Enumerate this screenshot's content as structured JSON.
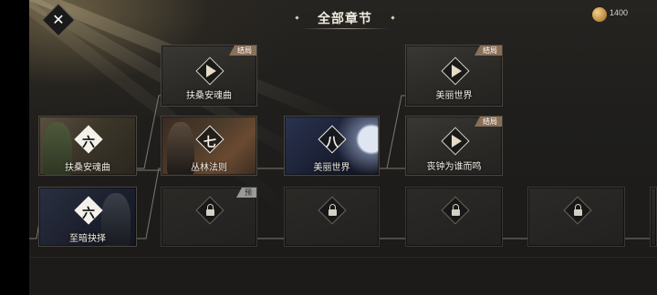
{
  "header": {
    "title": "全部章节",
    "coins": "1400"
  },
  "colors": {
    "ending_badge": "#8a6f57",
    "preview_badge": "#9a9a9a",
    "background": "#1f1e1c",
    "text": "#f3eee4"
  },
  "chapters": {
    "ch6_upper": {
      "number": "六",
      "name": "扶桑安魂曲"
    },
    "ch6_lower": {
      "number": "六",
      "name": "至暗抉择"
    },
    "ch7": {
      "number": "七",
      "name": "丛林法则"
    },
    "ch8": {
      "number": "八",
      "name": "美丽世界"
    }
  },
  "endings": {
    "ending_a": {
      "badge": "结局",
      "name": "扶桑安魂曲"
    },
    "ending_b": {
      "badge": "结局",
      "name": "美丽世界"
    },
    "ending_c": {
      "badge": "结局",
      "name": "丧钟为谁而鸣"
    }
  },
  "locked": {
    "preview_badge": "预"
  },
  "icons": [
    "close-icon",
    "coin-icon",
    "play-icon",
    "lock-icon"
  ]
}
